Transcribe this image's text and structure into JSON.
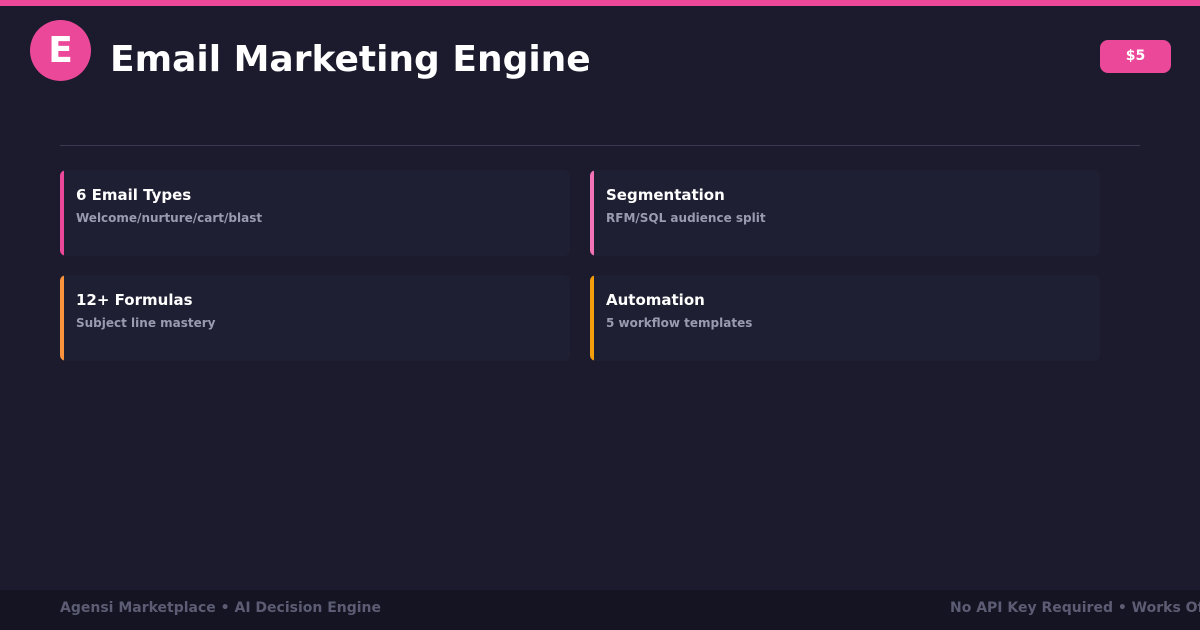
{
  "colors": {
    "background": "#1b1b2d",
    "brand": "#ec4899",
    "card": "#1f1f33",
    "accent_pink": "#ec4899",
    "accent_light_pink": "#f472b6",
    "accent_orange": "#fb923c",
    "accent_amber": "#f59e0b"
  },
  "header": {
    "logo_letter": "E",
    "title": "Email Marketing Engine",
    "price": "$5"
  },
  "features": [
    {
      "title": "6 Email Types",
      "subtitle": "Welcome/nurture/cart/blast",
      "accent": "#ec4899"
    },
    {
      "title": "Segmentation",
      "subtitle": "RFM/SQL audience split",
      "accent": "#f472b6"
    },
    {
      "title": "12+ Formulas",
      "subtitle": "Subject line mastery",
      "accent": "#fb923c"
    },
    {
      "title": "Automation",
      "subtitle": "5 workflow templates",
      "accent": "#f59e0b"
    }
  ],
  "footer": {
    "left": "Agensi Marketplace • AI Decision Engine",
    "right": "No API Key Required • Works Offline"
  }
}
